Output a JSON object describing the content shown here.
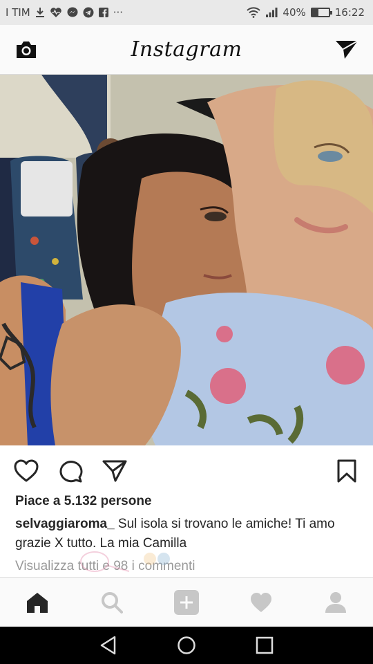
{
  "status_bar": {
    "carrier": "I TIM",
    "notification_icons": [
      "download-icon",
      "heartbeat-icon",
      "messenger-icon",
      "telegram-icon",
      "facebook-icon",
      "more-icon"
    ],
    "more": "···",
    "battery_percent": "40%",
    "battery_level": 0.4,
    "time": "16:22"
  },
  "header": {
    "brand": "Instagram",
    "camera_icon": "camera-icon",
    "direct_icon": "direct-message-icon"
  },
  "post": {
    "likes_text": "Piace a 5.132 persone",
    "username": "selvaggiaroma_",
    "caption": " Sul isola si trovano le amiche! Ti amo grazie X tutto. La mia Camilla",
    "comments_link": "Visualizza tutti e 98 i commenti"
  },
  "actions": {
    "like": "heart-icon",
    "comment": "comment-icon",
    "share": "send-icon",
    "save": "bookmark-icon"
  },
  "bottom_nav": [
    "home-icon",
    "search-icon",
    "add-icon",
    "activity-icon",
    "profile-icon"
  ],
  "colors": {
    "text": "#262626",
    "muted": "#999999",
    "border": "#dbdbdb",
    "bar": "#fafafa"
  }
}
